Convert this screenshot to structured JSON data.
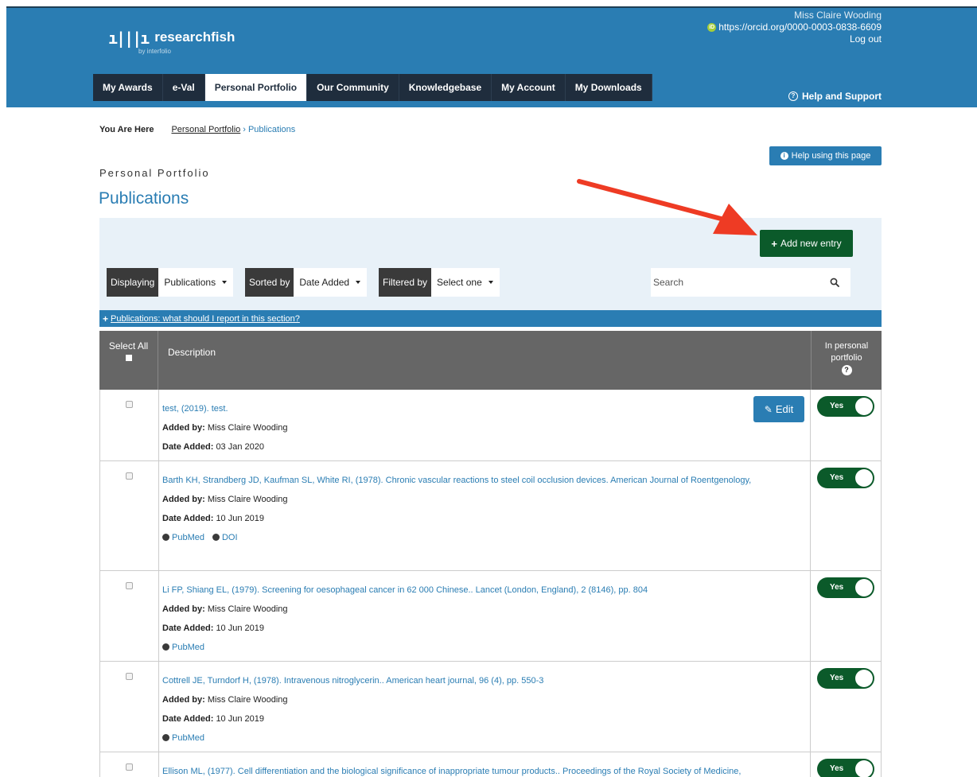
{
  "header": {
    "logo_text": "researchfish",
    "logo_sub": "by interfolio",
    "user_name": "Miss Claire Wooding",
    "orcid_url": "https://orcid.org/0000-0003-0838-6609",
    "logout": "Log out",
    "help_support": "Help and Support"
  },
  "nav": {
    "items": [
      {
        "label": "My Awards"
      },
      {
        "label": "e-Val"
      },
      {
        "label": "Personal Portfolio"
      },
      {
        "label": "Our Community"
      },
      {
        "label": "Knowledgebase"
      },
      {
        "label": "My Account"
      },
      {
        "label": "My Downloads"
      }
    ],
    "active": "Personal Portfolio"
  },
  "breadcrumb": {
    "here_label": "You Are Here",
    "parent": "Personal Portfolio",
    "separator": "›",
    "current": "Publications"
  },
  "page": {
    "help_button": "Help using this page",
    "kicker": "Personal Portfolio",
    "title": "Publications",
    "add_button": "Add new entry"
  },
  "filters": {
    "displaying_label": "Displaying",
    "displaying_value": "Publications",
    "sorted_label": "Sorted by",
    "sorted_value": "Date Added",
    "filtered_label": "Filtered by",
    "filtered_value": "Select one",
    "search_placeholder": "Search"
  },
  "guidance": {
    "text": "Publications: what should I report in this section?"
  },
  "table": {
    "col_select": "Select All",
    "col_description": "Description",
    "col_portfolio_1": "In personal",
    "col_portfolio_2": "portfolio",
    "added_by_label": "Added by:",
    "date_added_label": "Date Added:",
    "toggle_label": "Yes",
    "edit_label": "Edit",
    "rows": [
      {
        "citation": "test, (2019). test.",
        "added_by": "Miss Claire Wooding",
        "date_added": "03 Jan 2020",
        "links": []
      },
      {
        "citation": "Barth KH, Strandberg JD, Kaufman SL, White RI, (1978). Chronic vascular reactions to steel coil occlusion devices. American Journal of Roentgenology,",
        "added_by": "Miss Claire Wooding",
        "date_added": "10 Jun 2019",
        "links": [
          "PubMed",
          "DOI"
        ]
      },
      {
        "citation": "Li FP, Shiang EL, (1979). Screening for oesophageal cancer in 62 000 Chinese.. Lancet (London, England), 2 (8146), pp. 804",
        "added_by": "Miss Claire Wooding",
        "date_added": "10 Jun 2019",
        "links": [
          "PubMed"
        ]
      },
      {
        "citation": "Cottrell JE, Turndorf H, (1978). Intravenous nitroglycerin.. American heart journal, 96 (4), pp. 550-3",
        "added_by": "Miss Claire Wooding",
        "date_added": "10 Jun 2019",
        "links": [
          "PubMed"
        ]
      },
      {
        "citation": "Ellison ML, (1977). Cell differentiation and the biological significance of inappropriate tumour products.. Proceedings of the Royal Society of Medicine,",
        "added_by": "",
        "date_added": "",
        "links": []
      }
    ]
  },
  "colors": {
    "brand_blue": "#2a7db3",
    "nav_dark": "#1f2d3d",
    "action_green": "#0b5a2a",
    "annotation_arrow": "#ee3b24"
  }
}
